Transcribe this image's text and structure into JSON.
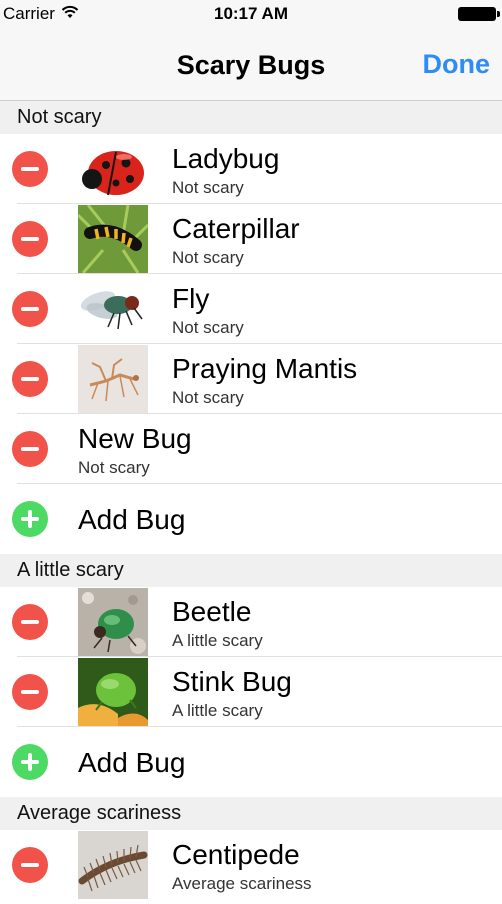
{
  "status_bar": {
    "carrier": "Carrier",
    "time": "10:17 AM"
  },
  "nav": {
    "title": "Scary Bugs",
    "done_label": "Done"
  },
  "sections": [
    {
      "header": "Not scary",
      "rows": [
        {
          "title": "Ladybug",
          "subtitle": "Not scary",
          "image": "ladybug"
        },
        {
          "title": "Caterpillar",
          "subtitle": "Not scary",
          "image": "caterpillar"
        },
        {
          "title": "Fly",
          "subtitle": "Not scary",
          "image": "fly"
        },
        {
          "title": "Praying Mantis",
          "subtitle": "Not scary",
          "image": "praying-mantis"
        },
        {
          "title": "New Bug",
          "subtitle": "Not scary",
          "image": null
        }
      ],
      "add_label": "Add Bug"
    },
    {
      "header": "A little scary",
      "rows": [
        {
          "title": "Beetle",
          "subtitle": "A little scary",
          "image": "beetle"
        },
        {
          "title": "Stink Bug",
          "subtitle": "A little scary",
          "image": "stink-bug"
        }
      ],
      "add_label": "Add Bug"
    },
    {
      "header": "Average scariness",
      "rows": [
        {
          "title": "Centipede",
          "subtitle": "Average scariness",
          "image": "centipede"
        }
      ]
    }
  ],
  "colors": {
    "delete": "#f1524a",
    "insert": "#4cd964",
    "accent": "#2f8cf5"
  }
}
